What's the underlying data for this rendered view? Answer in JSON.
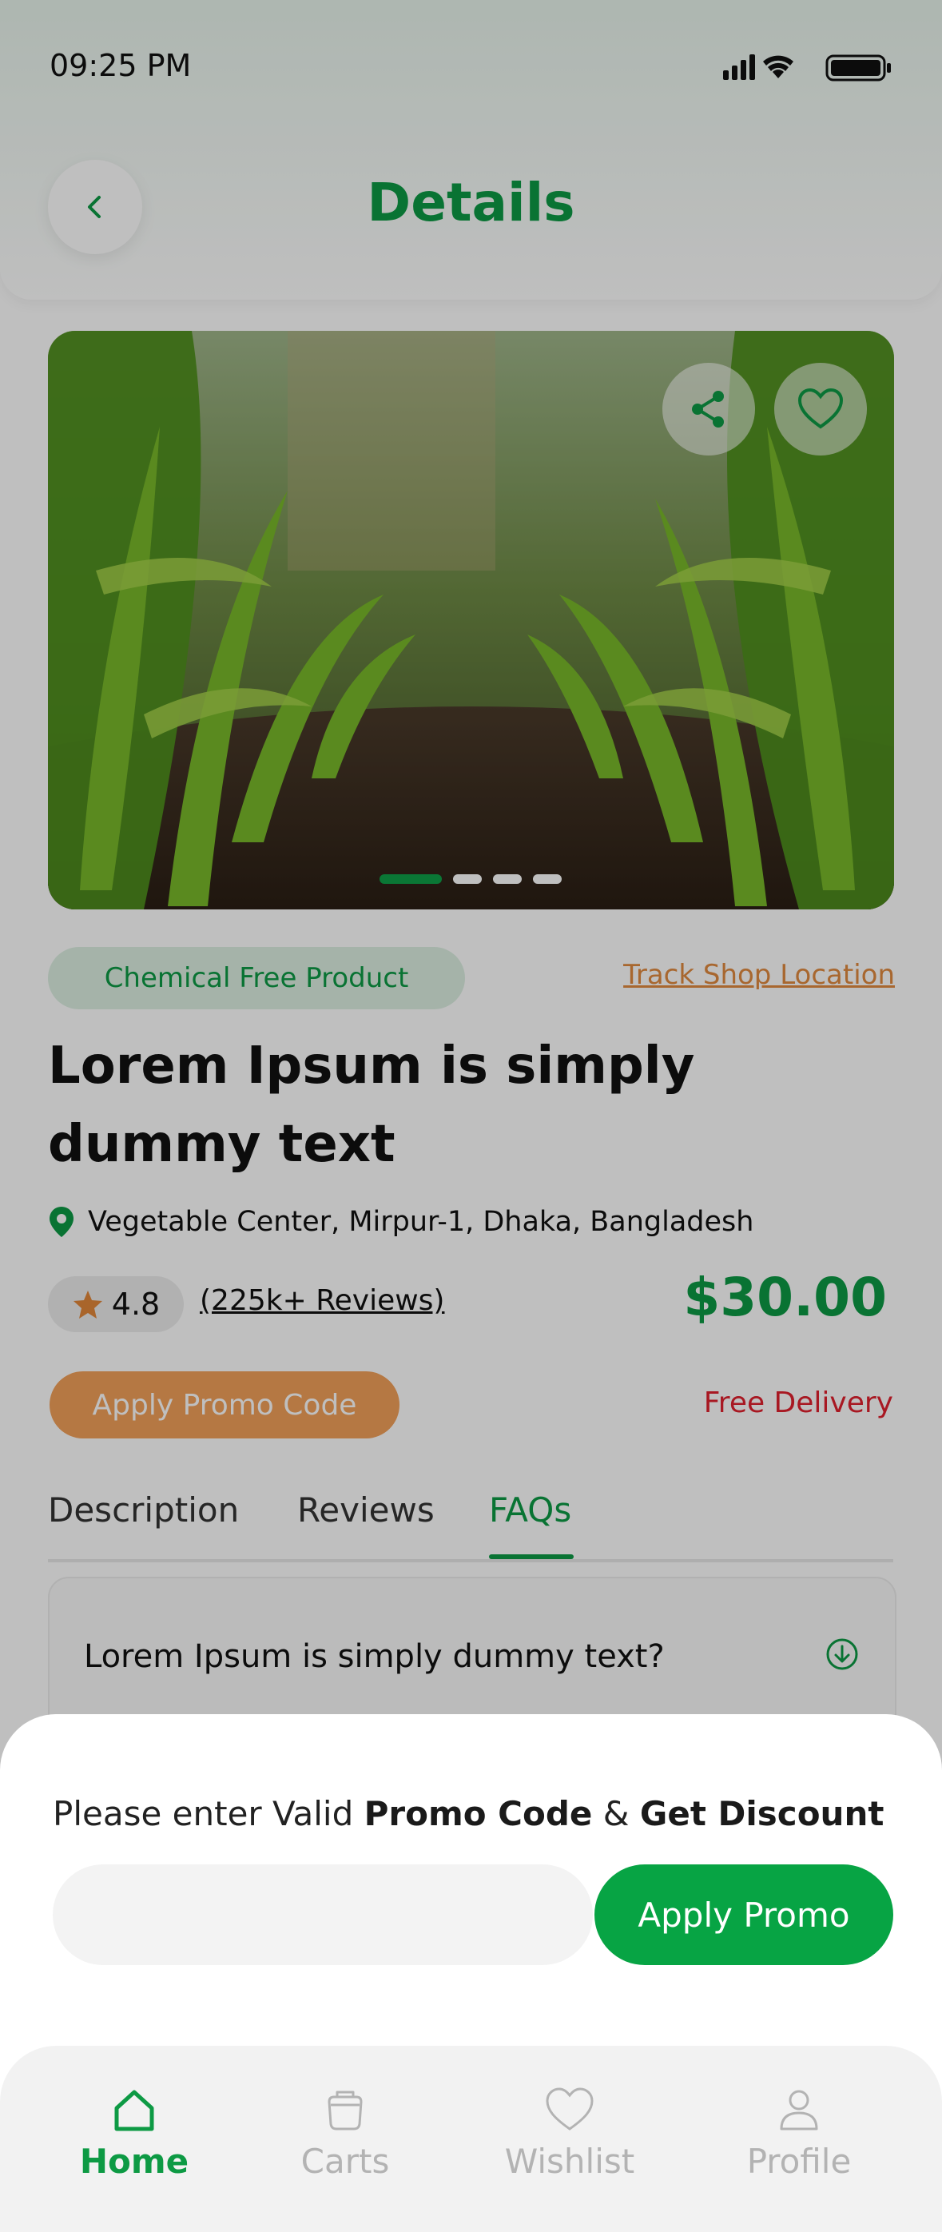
{
  "status_bar": {
    "time": "09:25 PM"
  },
  "header": {
    "title": "Details"
  },
  "hero": {
    "image_description_icon": "corn-field-photo",
    "active_slide": 1,
    "total_slides": 4
  },
  "product": {
    "badge": "Chemical Free Product",
    "track_link": "Track Shop Location",
    "name": "Lorem Ipsum is simply dummy text",
    "location": "Vegetable Center, Mirpur-1, Dhaka, Bangladesh",
    "rating": "4.8",
    "reviews": "(225k+ Reviews)",
    "price": "$30.00",
    "promo_button": "Apply Promo Code",
    "delivery": "Free Delivery"
  },
  "tabs": [
    {
      "label": "Description",
      "active": false
    },
    {
      "label": "Reviews",
      "active": false
    },
    {
      "label": "FAQs",
      "active": true
    }
  ],
  "faq": {
    "question": "Lorem Ipsum is simply dummy text?"
  },
  "promo_sheet": {
    "message_prefix": "Please enter Valid ",
    "message_bold_1": "Promo Code",
    "message_mid": " & ",
    "message_bold_2": "Get Discount",
    "input_value": "",
    "input_placeholder": "",
    "apply_label": "Apply Promo"
  },
  "bottom_nav": [
    {
      "label": "Home",
      "icon": "home-icon",
      "active": true
    },
    {
      "label": "Carts",
      "icon": "cart-icon",
      "active": false
    },
    {
      "label": "Wishlist",
      "icon": "heart-icon",
      "active": false
    },
    {
      "label": "Profile",
      "icon": "profile-icon",
      "active": false
    }
  ],
  "colors": {
    "primary": "#0d9a44",
    "accent": "#f2a05a",
    "danger": "#e0202e"
  }
}
